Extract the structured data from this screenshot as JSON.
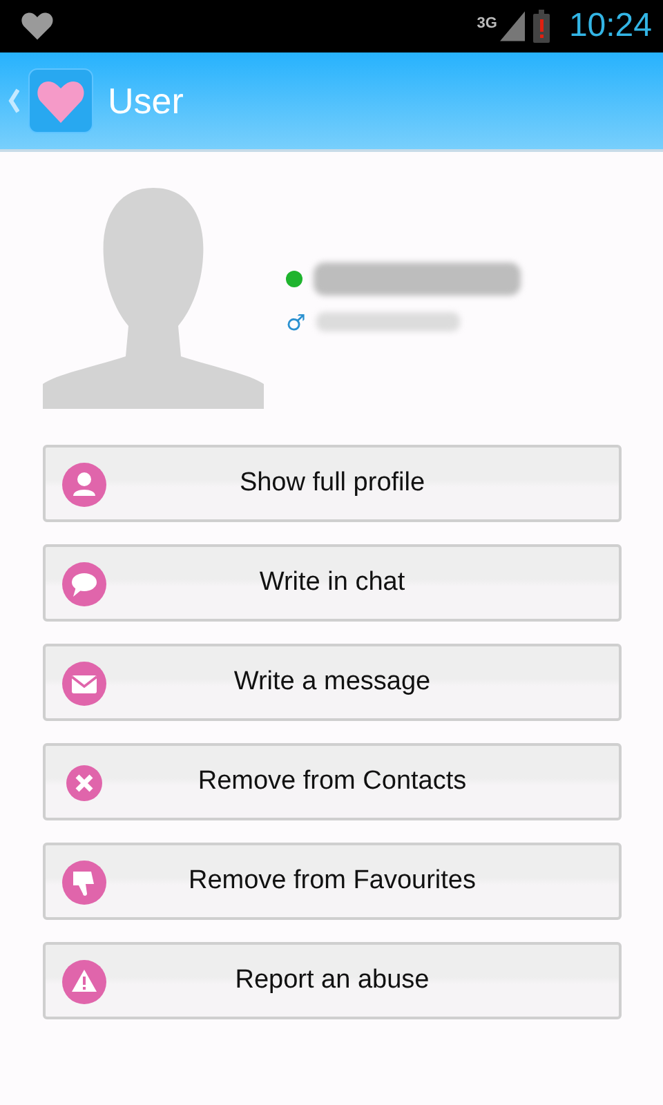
{
  "status_bar": {
    "network": "3G",
    "time": "10:24"
  },
  "header": {
    "title": "User"
  },
  "profile": {
    "online": true,
    "gender_symbol": "♂"
  },
  "actions": [
    {
      "kind": "profile",
      "label": "Show full profile"
    },
    {
      "kind": "chat",
      "label": "Write in chat"
    },
    {
      "kind": "message",
      "label": "Write a message"
    },
    {
      "kind": "remove",
      "label": "Remove from Contacts"
    },
    {
      "kind": "dislike",
      "label": "Remove from Favourites"
    },
    {
      "kind": "report",
      "label": "Report an abuse"
    }
  ]
}
